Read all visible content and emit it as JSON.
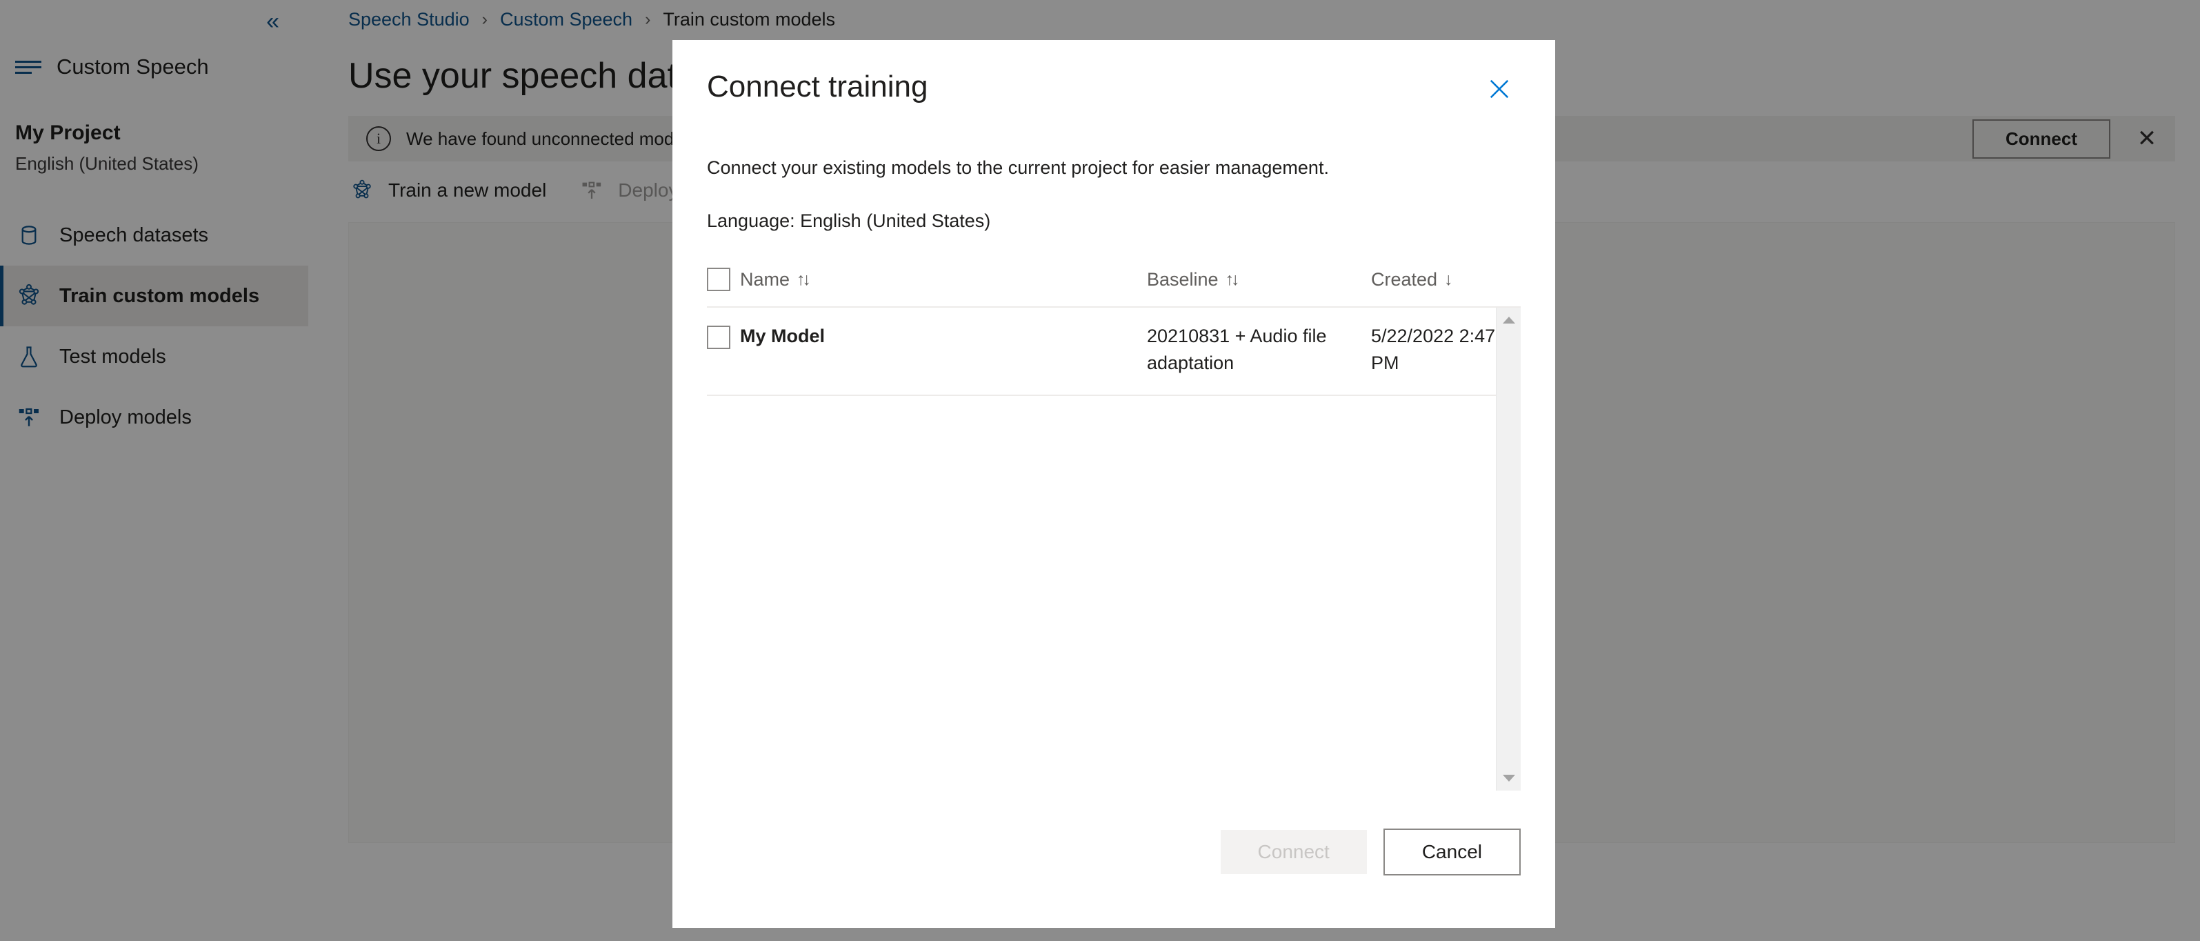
{
  "sidebar": {
    "collapse_glyph": "«",
    "app_label": "Custom Speech",
    "project_name": "My Project",
    "project_locale": "English (United States)",
    "items": [
      {
        "label": "Speech datasets",
        "icon": "database-icon",
        "active": false
      },
      {
        "label": "Train custom models",
        "icon": "model-graph-icon",
        "active": true
      },
      {
        "label": "Test models",
        "icon": "flask-icon",
        "active": false
      },
      {
        "label": "Deploy models",
        "icon": "deploy-upload-icon",
        "active": false
      }
    ]
  },
  "breadcrumb": {
    "items": [
      "Speech Studio",
      "Custom Speech",
      "Train custom models"
    ],
    "separator": "›"
  },
  "page": {
    "title": "Use your speech data"
  },
  "notice": {
    "icon": "info-icon",
    "text": "We have found unconnected models … u want to connect these entities to this project so you can …",
    "connect_label": "Connect",
    "dismiss_glyph": "✕"
  },
  "toolbar": {
    "train_label": "Train a new model",
    "deploy_label": "Deploy models"
  },
  "modal": {
    "title": "Connect training",
    "close_icon": "close-icon",
    "description": "Connect your existing models to the current project for easier management.",
    "language_line": "Language: English (United States)",
    "table": {
      "select_all_checked": false,
      "columns": [
        {
          "label": "Name",
          "sort_glyph": "↑↓"
        },
        {
          "label": "Baseline",
          "sort_glyph": "↑↓"
        },
        {
          "label": "Created",
          "sort_glyph": "↓"
        }
      ],
      "rows": [
        {
          "selected": false,
          "name": "My Model",
          "baseline": "20210831 + Audio file adaptation",
          "created": "5/22/2022 2:47 PM"
        }
      ]
    },
    "footer": {
      "connect_label": "Connect",
      "connect_disabled": true,
      "cancel_label": "Cancel"
    }
  },
  "colors": {
    "accent": "#0f548c",
    "link": "#0078d4",
    "text": "#201f1e",
    "muted": "#605e5c",
    "nav_active_bg": "#edebe9",
    "notice_bg": "#f3f2f1",
    "overlay": "rgba(0,0,0,0.45)"
  }
}
